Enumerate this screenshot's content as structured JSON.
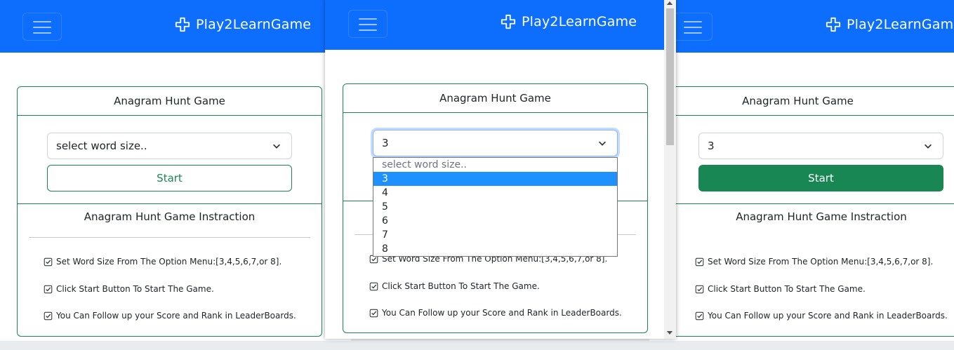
{
  "brand": {
    "name": "Play2LearnGame",
    "icon": "puzzle-plus-icon"
  },
  "colors": {
    "navbar": "#0d6efd",
    "accent": "#198754",
    "selected_option": "#1e90ff"
  },
  "game": {
    "title": "Anagram Hunt Game",
    "instructions_title": "Anagram Hunt Game Instraction",
    "instructions": [
      "Set Word Size From The Option Menu:[3,4,5,6,7,or 8].",
      "Click Start Button To Start The Game.",
      "You Can Follow up your Score and Rank in LeaderBoards."
    ],
    "start_label": "Start"
  },
  "panels": [
    {
      "select_value": "select word size..",
      "start_style": "outline"
    },
    {
      "select_value": "3",
      "dropdown_open": true
    },
    {
      "select_value": "3",
      "start_style": "solid"
    }
  ],
  "dropdown": {
    "options": [
      "select word size..",
      "3",
      "4",
      "5",
      "6",
      "7",
      "8"
    ],
    "selected": "3"
  }
}
